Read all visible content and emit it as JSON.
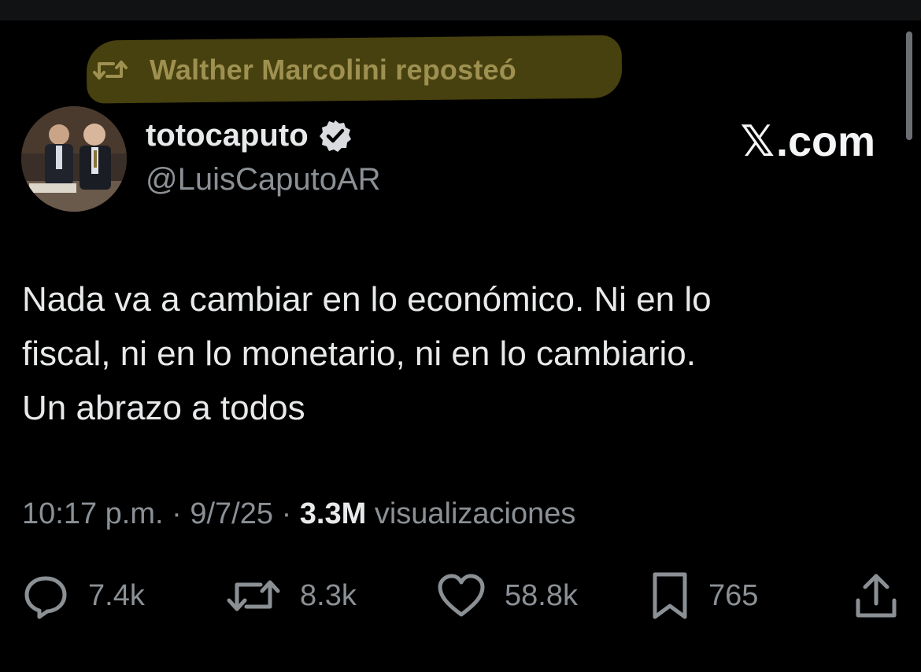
{
  "repost": {
    "text": "Walther Marcolini reposteó"
  },
  "author": {
    "display_name": "totocaputo",
    "handle": "@LuisCaputoAR",
    "verified": true,
    "avatar": "avatar-photo-two-men"
  },
  "brand": {
    "x": "𝕏",
    "suffix": ".com"
  },
  "tweet": {
    "lines": [
      "Nada va a cambiar en lo económico. Ni en lo",
      "fiscal, ni en lo monetario, ni en lo cambiario.",
      "Un abrazo a todos"
    ]
  },
  "meta": {
    "time": "10:17 p.m.",
    "sep": "·",
    "date": "9/7/25",
    "views": "3.3M",
    "views_label": "visualizaciones"
  },
  "actions": {
    "replies": "7.4k",
    "reposts": "8.3k",
    "likes": "58.8k",
    "bookmarks": "765"
  },
  "colors": {
    "background": "#000000",
    "text": "#e7e9ea",
    "muted": "#8b9095",
    "highlight": "#4b4310",
    "highlight_text": "#9e9050"
  }
}
